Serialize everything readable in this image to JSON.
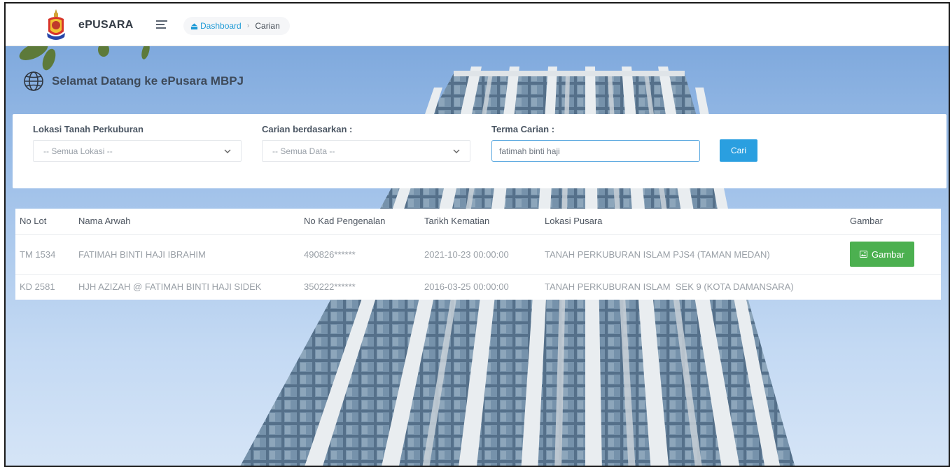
{
  "header": {
    "brand": "ePUSARA",
    "breadcrumb": {
      "home": "Dashboard",
      "current": "Carian"
    }
  },
  "welcome": {
    "title": "Selamat Datang ke ePusara MBPJ"
  },
  "search": {
    "location": {
      "label": "Lokasi Tanah Perkuburan",
      "selected": "-- Semua Lokasi --"
    },
    "criteria": {
      "label": "Carian berdasarkan :",
      "selected": "-- Semua Data --"
    },
    "term": {
      "label": "Terma Carian :",
      "value": "fatimah binti haji"
    },
    "button": "Cari"
  },
  "table": {
    "columns": [
      "No Lot",
      "Nama Arwah",
      "No Kad Pengenalan",
      "Tarikh Kematian",
      "Lokasi Pusara",
      "Gambar"
    ],
    "rows": [
      {
        "lot": "TM 1534",
        "name": "FATIMAH BINTI HAJI IBRAHIM",
        "ic": "490826******",
        "date": "2021-10-23 00:00:00",
        "location": "TANAH PERKUBURAN ISLAM PJS4 (TAMAN MEDAN)",
        "button": "Gambar"
      },
      {
        "lot": "KD 2581",
        "name": "HJH AZIZAH @ FATIMAH BINTI HAJI SIDEK",
        "ic": "350222******",
        "date": "2016-03-25 00:00:00",
        "location": "TANAH PERKUBURAN ISLAM  SEK 9 (KOTA DAMANSARA)",
        "button": ""
      }
    ]
  },
  "icons": {
    "home": "home-icon",
    "menu": "hamburger-menu-icon",
    "globe": "globe-icon",
    "chevron": "chevron-down-icon",
    "image": "image-icon"
  },
  "colors": {
    "accent": "#2a9fe0",
    "success": "#4cb050",
    "link": "#1f9ad6"
  }
}
